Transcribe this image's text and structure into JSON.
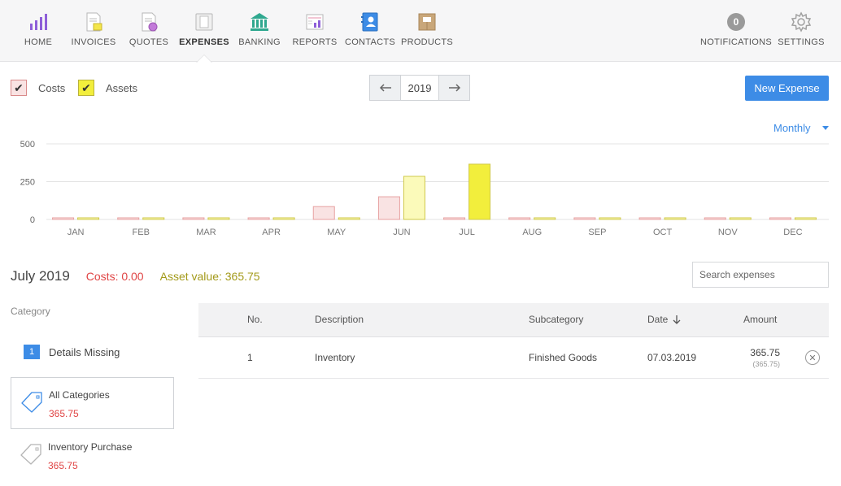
{
  "nav": {
    "items": [
      {
        "label": "HOME",
        "icon": "bar-chart-icon"
      },
      {
        "label": "INVOICES",
        "icon": "invoice-icon"
      },
      {
        "label": "QUOTES",
        "icon": "quote-icon"
      },
      {
        "label": "EXPENSES",
        "icon": "expense-icon",
        "active": true
      },
      {
        "label": "BANKING",
        "icon": "bank-icon"
      },
      {
        "label": "REPORTS",
        "icon": "report-icon"
      },
      {
        "label": "CONTACTS",
        "icon": "contacts-icon"
      },
      {
        "label": "PRODUCTS",
        "icon": "products-icon"
      }
    ],
    "notifications": {
      "label": "NOTIFICATIONS",
      "count": "0"
    },
    "settings": {
      "label": "SETTINGS",
      "icon": "gear-icon"
    }
  },
  "toolbar": {
    "costs_label": "Costs",
    "assets_label": "Assets",
    "year": "2019",
    "new_expense_label": "New Expense",
    "period_label": "Monthly"
  },
  "colors": {
    "costs_fill": "#f9e3e3",
    "costs_stroke": "#e7a1a1",
    "assets_fill": "#fbfaba",
    "assets_stroke": "#cfc84a",
    "assets_active_fill": "#f2ee3c",
    "accent": "#3d8ce6"
  },
  "chart_data": {
    "type": "bar",
    "categories": [
      "JAN",
      "FEB",
      "MAR",
      "APR",
      "MAY",
      "JUN",
      "JUL",
      "AUG",
      "SEP",
      "OCT",
      "NOV",
      "DEC"
    ],
    "series": [
      {
        "name": "Costs",
        "values": [
          0,
          0,
          0,
          0,
          85,
          150,
          0,
          0,
          0,
          0,
          0,
          0
        ]
      },
      {
        "name": "Assets",
        "values": [
          0,
          0,
          0,
          0,
          0,
          285,
          365.75,
          0,
          0,
          0,
          0,
          0
        ]
      }
    ],
    "yticks": [
      0,
      250,
      500
    ],
    "ylim": [
      0,
      500
    ],
    "selected": "JUL"
  },
  "summary": {
    "month": "July 2019",
    "costs": "Costs: 0.00",
    "asset_value": "Asset value: 365.75"
  },
  "search": {
    "placeholder": "Search expenses"
  },
  "categories": {
    "heading": "Category",
    "details_missing": {
      "count": "1",
      "label": "Details Missing"
    },
    "items": [
      {
        "name": "All Categories",
        "amount": "365.75",
        "selected": true
      },
      {
        "name": "Inventory Purchase",
        "amount": "365.75"
      }
    ]
  },
  "table": {
    "headers": {
      "no": "No.",
      "description": "Description",
      "subcategory": "Subcategory",
      "date": "Date",
      "amount": "Amount"
    },
    "rows": [
      {
        "no": "1",
        "description": "Inventory",
        "subcategory": "Finished Goods",
        "date": "07.03.2019",
        "amount": "365.75",
        "amount_sub": "(365.75)"
      }
    ]
  }
}
